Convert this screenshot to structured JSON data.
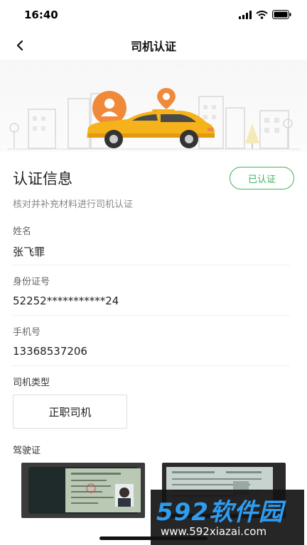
{
  "status_bar": {
    "time": "16:40"
  },
  "nav": {
    "title": "司机认证"
  },
  "info": {
    "title": "认证信息",
    "status": "已认证",
    "subtitle": "核对并补充材料进行司机认证"
  },
  "fields": [
    {
      "label": "姓名",
      "value": "张飞罪"
    },
    {
      "label": "身份证号",
      "value": "52252***********24"
    },
    {
      "label": "手机号",
      "value": "13368537206"
    }
  ],
  "driver_type": {
    "label": "司机类型",
    "value": "正职司机"
  },
  "license": {
    "label": "驾驶证"
  },
  "watermark": {
    "logo": "592软件园",
    "url": "www.592xiazai.com"
  },
  "colors": {
    "accent": "#3fb260",
    "taxi_yellow": "#f5b21a",
    "pin_orange": "#f08a3a"
  },
  "icons": [
    "back-arrow-icon",
    "signal-icon",
    "wifi-icon",
    "battery-icon"
  ]
}
